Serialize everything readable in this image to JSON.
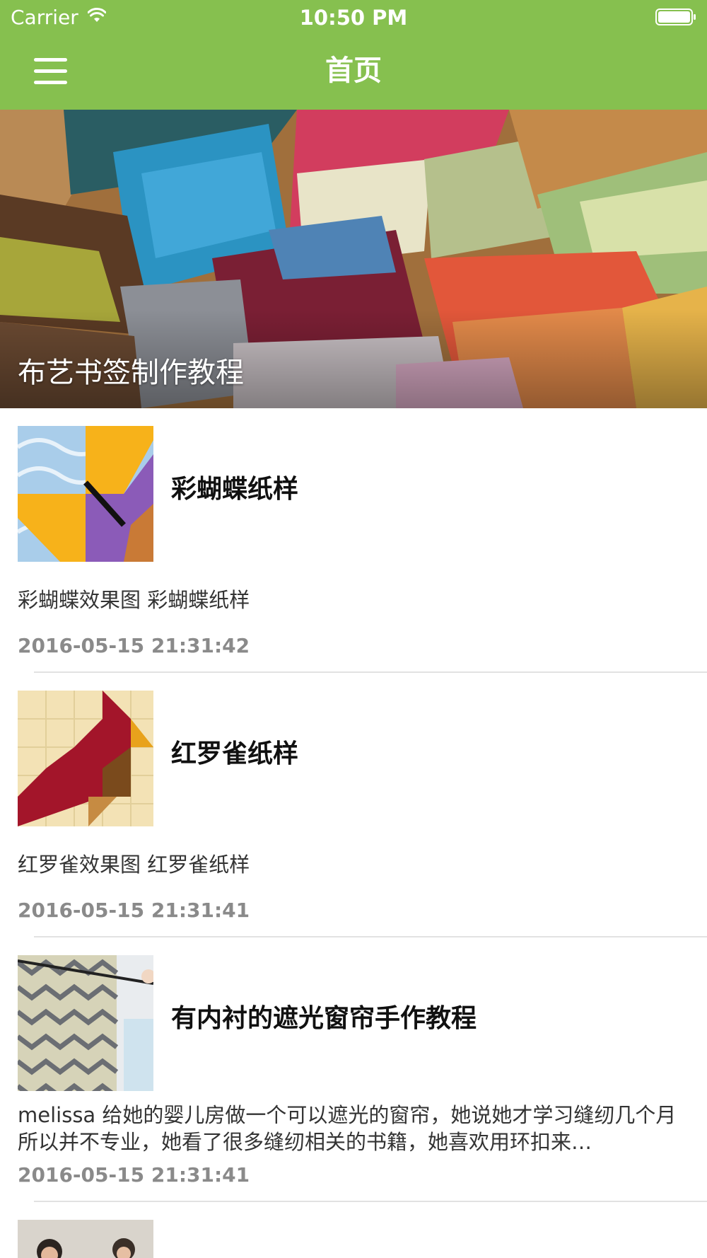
{
  "status_bar": {
    "carrier": "Carrier",
    "time": "10:50 PM",
    "icons": [
      "wifi-icon",
      "battery-icon"
    ]
  },
  "nav": {
    "title": "首页",
    "menu_icon": "menu-icon"
  },
  "hero": {
    "caption": "布艺书签制作教程"
  },
  "articles": [
    {
      "title": "彩蝴蝶纸样",
      "summary": "彩蝴蝶效果图 彩蝴蝶纸样",
      "date": "2016-05-15 21:31:42"
    },
    {
      "title": "红罗雀纸样",
      "summary": "红罗雀效果图 红罗雀纸样",
      "date": "2016-05-15 21:31:41"
    },
    {
      "title": "有内衬的遮光窗帘手作教程",
      "summary": "melissa 给她的婴儿房做一个可以遮光的窗帘，她说她才学习缝纫几个月所以并不专业，她看了很多缝纫相关的书籍，她喜欢用环扣来…",
      "date": "2016-05-15 21:31:41"
    }
  ],
  "colors": {
    "nav_background": "#86c04f",
    "title_text": "#111111",
    "summary_text": "#333333",
    "date_text": "#8a8a8a"
  }
}
